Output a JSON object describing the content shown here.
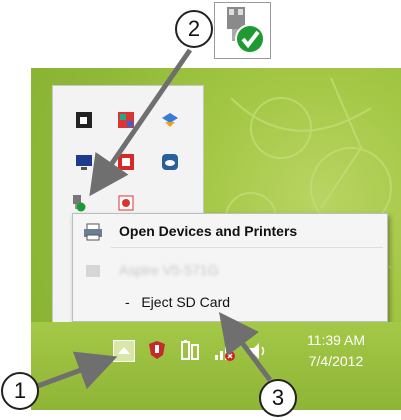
{
  "context_menu": {
    "open_devices": "Open Devices and Printers",
    "device_name": "Aspire V5-571G",
    "eject": "-   Eject SD Card"
  },
  "clock": {
    "time": "11:39 AM",
    "date": "7/4/2012"
  },
  "callouts": {
    "one": "1",
    "two": "2",
    "three": "3"
  },
  "colors": {
    "desktop_green": "#9fc440",
    "menu_bg": "#f5f5f5",
    "badge_green": "#1f9a32"
  },
  "icons": [
    "safely-remove-hardware-icon",
    "show-hidden-icons-arrow",
    "battery-icon",
    "network-icon",
    "volume-icon",
    "printer-icon"
  ]
}
